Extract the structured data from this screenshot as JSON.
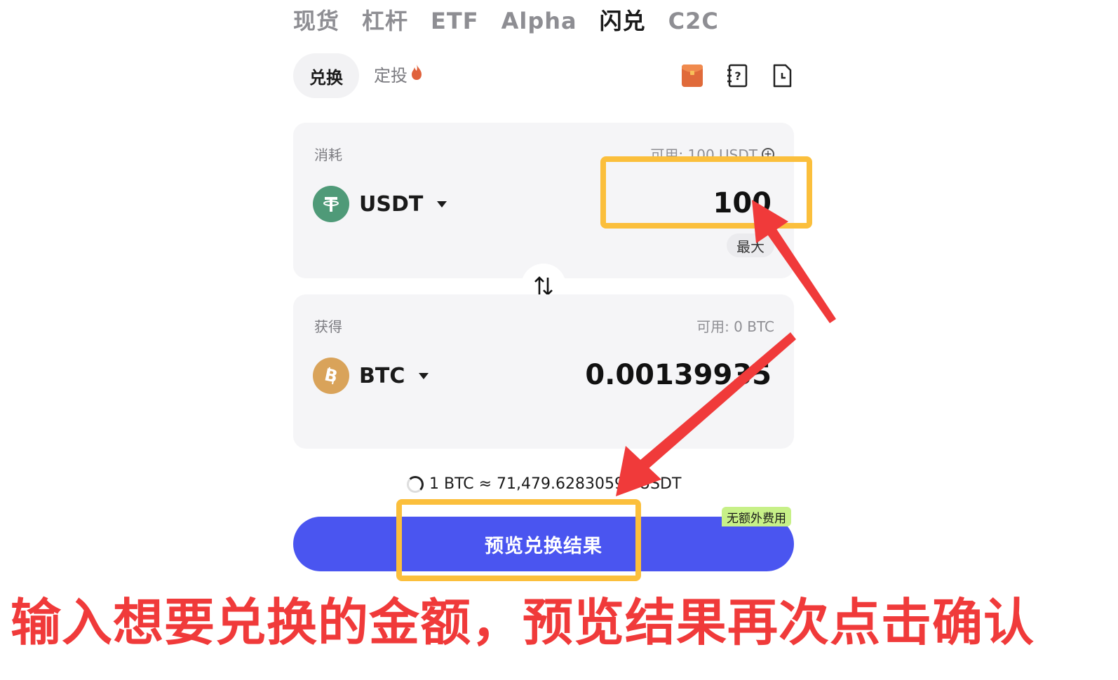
{
  "top_tabs": [
    {
      "label": "现货",
      "active": false
    },
    {
      "label": "杠杆",
      "active": false
    },
    {
      "label": "ETF",
      "active": false
    },
    {
      "label": "Alpha",
      "active": false
    },
    {
      "label": "闪兑",
      "active": true
    },
    {
      "label": "C2C",
      "active": false
    }
  ],
  "mode": {
    "convert_label": "兑换",
    "dca_label": "定投",
    "dca_icon": "flame-icon"
  },
  "toolbar": {
    "icons": [
      "red-packet-icon",
      "help-icon",
      "history-icon"
    ]
  },
  "spend": {
    "label": "消耗",
    "available": "可用: 100 USDT",
    "coin": "USDT",
    "amount": "100",
    "max_label": "最大"
  },
  "receive": {
    "label": "获得",
    "available": "可用: 0 BTC",
    "coin": "BTC",
    "amount": "0.00139935"
  },
  "rate": {
    "text": "1 BTC ≈ 71,479.62830591 USDT"
  },
  "action": {
    "preview_label": "预览兑换结果",
    "fee_badge": "无额外费用"
  },
  "annotation": {
    "caption": "输入想要兑换的金额，预览结果再次点击确认",
    "highlight_color": "#fbbf3c",
    "arrow_color": "#f03a3a"
  },
  "colors": {
    "primary_button": "#4a55f0",
    "usdt": "#4f9a78",
    "btc": "#d9a35a",
    "badge": "#c7f088"
  }
}
